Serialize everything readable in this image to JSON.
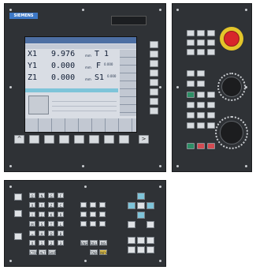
{
  "brand": "SIEMENS",
  "screen": {
    "axes": [
      {
        "name": "X1",
        "value": "9.976",
        "unit": "mm"
      },
      {
        "name": "Y1",
        "value": "0.000",
        "unit": "mm"
      },
      {
        "name": "Z1",
        "value": "0.000",
        "unit": "mm"
      }
    ],
    "tool_label": "T 1",
    "feed_label": "F",
    "spindle_label": "S1",
    "feed_value": "0.000",
    "spindle_value": "0.000"
  },
  "softkeys": {
    "left_arrow": "^",
    "right_arrow": ">"
  },
  "keyboard": {
    "rows": [
      [
        "O",
        "N",
        "G",
        "F"
      ],
      [
        "X",
        "Y",
        "Z",
        "C"
      ],
      [
        "I",
        "J",
        "K",
        "R"
      ],
      [
        "M",
        "S",
        "T",
        "L"
      ],
      [
        "=",
        "H",
        "D",
        "B"
      ],
      [
        "0",
        "1",
        "2",
        "3"
      ]
    ],
    "special": [
      "CTRL",
      "ALT",
      "SHIFT",
      "END",
      "DEL",
      "INS",
      "TAB",
      "INPUT"
    ]
  },
  "colors": {
    "panel": "#2f3236",
    "screen": "#d9dde4",
    "estop": "#d8262b",
    "green": "#2e8f66",
    "red": "#d44b52",
    "cursor": "#7ec4d9"
  }
}
